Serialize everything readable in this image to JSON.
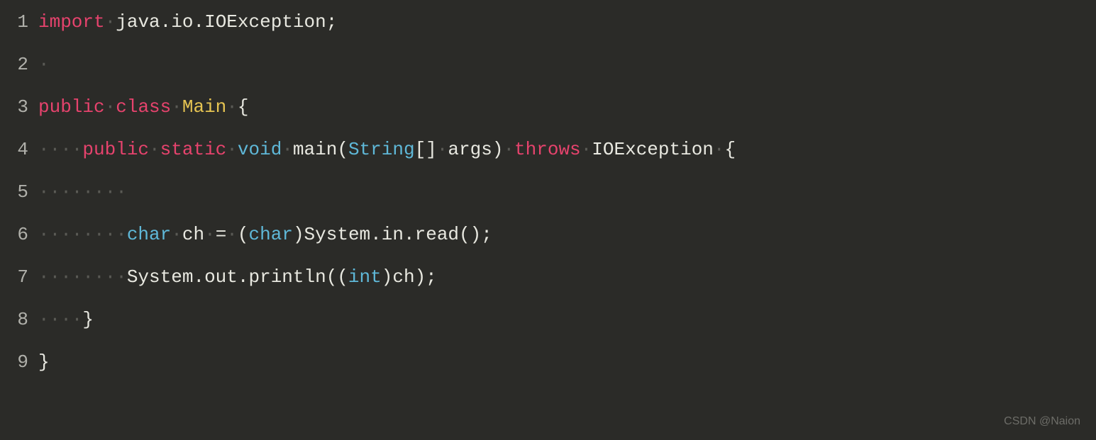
{
  "watermark": "CSDN @Naion",
  "lines": {
    "l1": {
      "num": "1",
      "t1": "import",
      "t2": "java",
      "t3": ".",
      "t4": "io",
      "t5": ".",
      "t6": "IOException",
      "t7": ";"
    },
    "l2": {
      "num": "2"
    },
    "l3": {
      "num": "3",
      "t1": "public",
      "t2": "class",
      "t3": "Main",
      "t4": "{"
    },
    "l4": {
      "num": "4",
      "t1": "public",
      "t2": "static",
      "t3": "void",
      "t4": "main",
      "t5": "(",
      "t6": "String",
      "t7": "[]",
      "t8": "args",
      "t9": ")",
      "t10": "throws",
      "t11": "IOException",
      "t12": "{"
    },
    "l5": {
      "num": "5"
    },
    "l6": {
      "num": "6",
      "t1": "char",
      "t2": "ch",
      "t3": "=",
      "t4": "(",
      "t5": "char",
      "t6": ")",
      "t7": "System",
      "t8": ".",
      "t9": "in",
      "t10": ".",
      "t11": "read",
      "t12": "();"
    },
    "l7": {
      "num": "7",
      "t1": "System",
      "t2": ".",
      "t3": "out",
      "t4": ".",
      "t5": "println",
      "t6": "((",
      "t7": "int",
      "t8": ")",
      "t9": "ch",
      "t10": ");"
    },
    "l8": {
      "num": "8",
      "t1": "}"
    },
    "l9": {
      "num": "9",
      "t1": "}"
    }
  }
}
